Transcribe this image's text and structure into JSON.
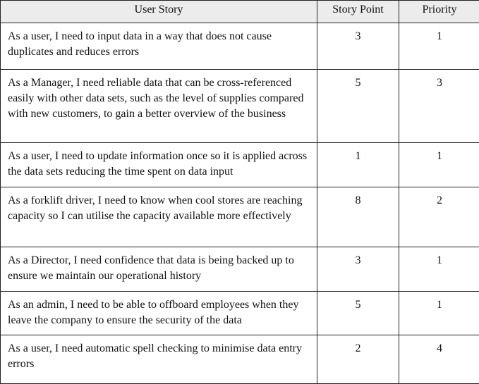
{
  "table": {
    "headers": [
      "User Story",
      "Story Point",
      "Priority"
    ],
    "rows": [
      {
        "story": "As a user, I need to input data in a way that does not cause duplicates and reduces errors",
        "story_point": "3",
        "priority": "1"
      },
      {
        "story": "As a Manager, I need reliable data that can be cross-referenced easily with other data sets, such as the level of supplies compared with new customers, to gain a better overview of the business",
        "story_point": "5",
        "priority": "3"
      },
      {
        "story": "As a user, I need to update information once so it is applied across the data sets reducing the time spent on data input",
        "story_point": "1",
        "priority": "1"
      },
      {
        "story": "As a forklift driver, I need to know when cool stores are reaching capacity so I can utilise the capacity available more effectively",
        "story_point": "8",
        "priority": "2"
      },
      {
        "story": "As a Director, I need confidence that data is being backed up to ensure we maintain our operational history",
        "story_point": "3",
        "priority": "1"
      },
      {
        "story": "As an admin, I need to be able to offboard employees when they leave the company to ensure the security of the data",
        "story_point": "5",
        "priority": "1"
      },
      {
        "story": "As a user, I need automatic spell checking to minimise data entry errors",
        "story_point": "2",
        "priority": "4"
      }
    ]
  }
}
